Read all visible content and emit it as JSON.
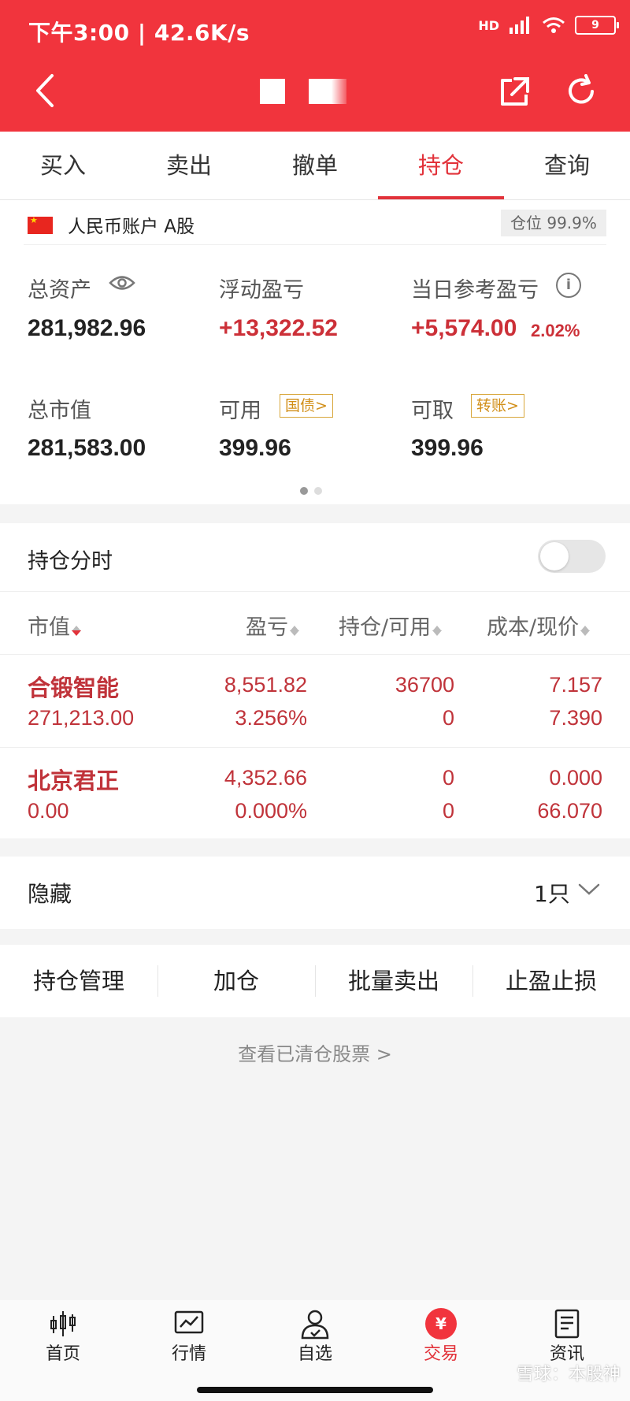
{
  "status_bar": {
    "time_speed": "下午3:00 | 42.6K/s",
    "network": "HD",
    "battery": "9"
  },
  "tabs": [
    {
      "label": "买入"
    },
    {
      "label": "卖出"
    },
    {
      "label": "撤单"
    },
    {
      "label": "持仓"
    },
    {
      "label": "查询"
    }
  ],
  "account": {
    "label": "人民币账户 A股",
    "position_ratio": "仓位 99.9%",
    "total_assets_label": "总资产",
    "total_assets": "281,982.96",
    "floating_pnl_label": "浮动盈亏",
    "floating_pnl": "+13,322.52",
    "daily_pnl_label": "当日参考盈亏",
    "daily_pnl": "+5,574.00",
    "daily_pnl_pct": "2.02%",
    "market_value_label": "总市值",
    "market_value": "281,583.00",
    "available_label": "可用",
    "available": "399.96",
    "bond_button": "国债>",
    "withdrawable_label": "可取",
    "withdrawable": "399.96",
    "transfer_button": "转账>"
  },
  "positions": {
    "title": "持仓分时",
    "headers": {
      "market_value": "市值",
      "pnl": "盈亏",
      "holding": "持仓/可用",
      "cost": "成本/现价"
    },
    "rows": [
      {
        "name": "合锻智能",
        "market_value": "271,213.00",
        "pnl": "8,551.82",
        "pnl_pct": "3.256%",
        "holding": "36700",
        "available": "0",
        "cost": "7.157",
        "price": "7.390"
      },
      {
        "name": "北京君正",
        "market_value": "0.00",
        "pnl": "4,352.66",
        "pnl_pct": "0.000%",
        "holding": "0",
        "available": "0",
        "cost": "0.000",
        "price": "66.070"
      }
    ]
  },
  "hidden": {
    "label": "隐藏",
    "count": "1只"
  },
  "actions": [
    {
      "label": "持仓管理"
    },
    {
      "label": "加仓"
    },
    {
      "label": "批量卖出"
    },
    {
      "label": "止盈止损"
    }
  ],
  "cleared_link": "查看已清仓股票 >",
  "bottom_nav": [
    {
      "label": "首页",
      "icon": "candlestick-icon"
    },
    {
      "label": "行情",
      "icon": "chart-icon"
    },
    {
      "label": "自选",
      "icon": "user-check-icon"
    },
    {
      "label": "交易",
      "icon": "yen-icon"
    },
    {
      "label": "资讯",
      "icon": "news-icon"
    }
  ],
  "trade_icon_glyph": "¥",
  "watermark": "雪球：本股神",
  "colors": {
    "brand_red": "#f1343d",
    "gain_red": "#c0333a",
    "badge_gold": "#d18e17"
  }
}
